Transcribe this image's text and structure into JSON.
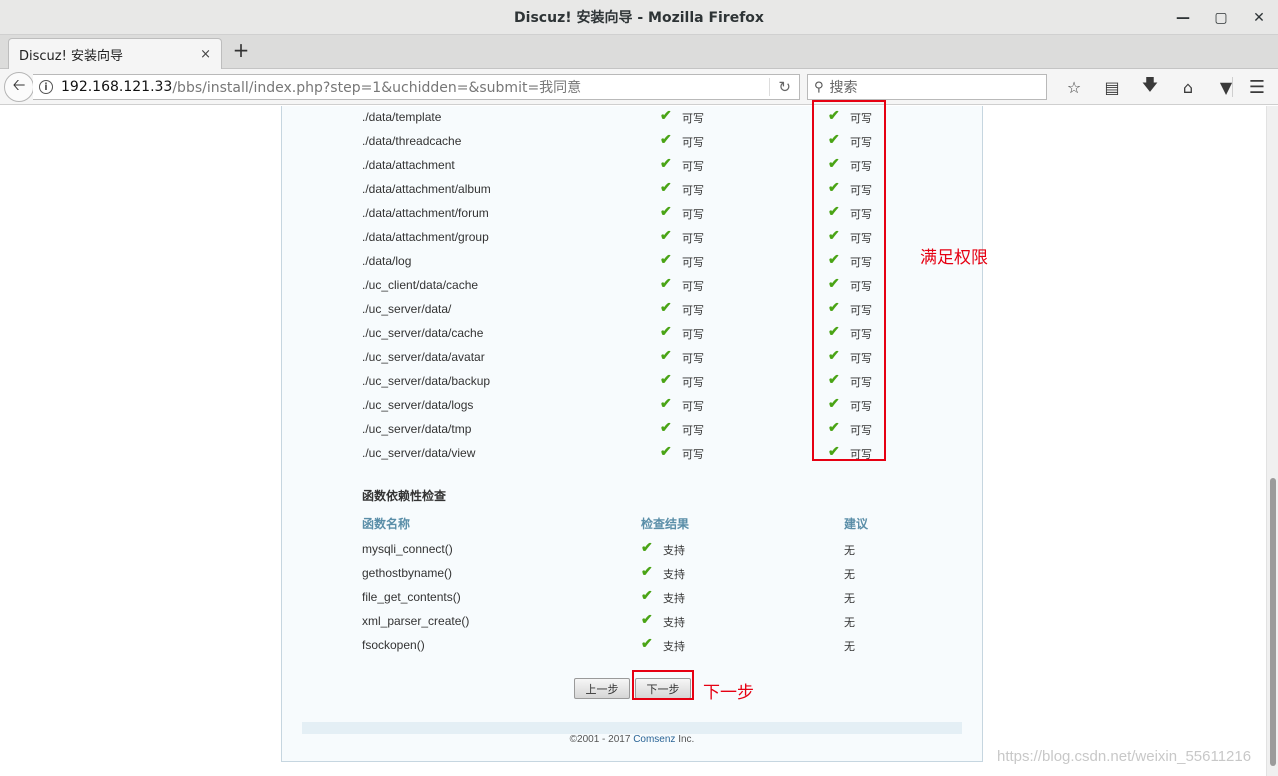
{
  "window": {
    "title": "Discuz! 安装向导  -  Mozilla Firefox"
  },
  "tab": {
    "title": "Discuz! 安装向导",
    "close": "×",
    "new": "+"
  },
  "nav": {
    "url_host": "192.168.121.33",
    "url_path": "/bbs/install/index.php?step=1&uchidden=&submit=我同意",
    "search_placeholder": "搜索"
  },
  "dirs": [
    "./data/template",
    "./data/threadcache",
    "./data/attachment",
    "./data/attachment/album",
    "./data/attachment/forum",
    "./data/attachment/group",
    "./data/log",
    "./uc_client/data/cache",
    "./uc_server/data/",
    "./uc_server/data/cache",
    "./uc_server/data/avatar",
    "./uc_server/data/backup",
    "./uc_server/data/logs",
    "./uc_server/data/tmp",
    "./uc_server/data/view"
  ],
  "writable_label": "可写",
  "func_section": {
    "title": "函数依赖性检查",
    "headers": [
      "函数名称",
      "检查结果",
      "建议"
    ],
    "rows": [
      {
        "name": "mysqli_connect()",
        "result": "支持",
        "suggest": "无"
      },
      {
        "name": "gethostbyname()",
        "result": "支持",
        "suggest": "无"
      },
      {
        "name": "file_get_contents()",
        "result": "支持",
        "suggest": "无"
      },
      {
        "name": "xml_parser_create()",
        "result": "支持",
        "suggest": "无"
      },
      {
        "name": "fsockopen()",
        "result": "支持",
        "suggest": "无"
      }
    ]
  },
  "buttons": {
    "prev": "上一步",
    "next": "下一步"
  },
  "footer": {
    "copyright_prefix": "©2001 - 2017 ",
    "brand": "Comsenz",
    "suffix": " Inc."
  },
  "annotations": {
    "perm_note": "满足权限",
    "next_note": "下一步"
  },
  "watermark": "https://blog.csdn.net/weixin_55611216",
  "colors": {
    "annotation": "#e60012",
    "check": "#4aa416",
    "header_blue": "#5a8ea8"
  }
}
